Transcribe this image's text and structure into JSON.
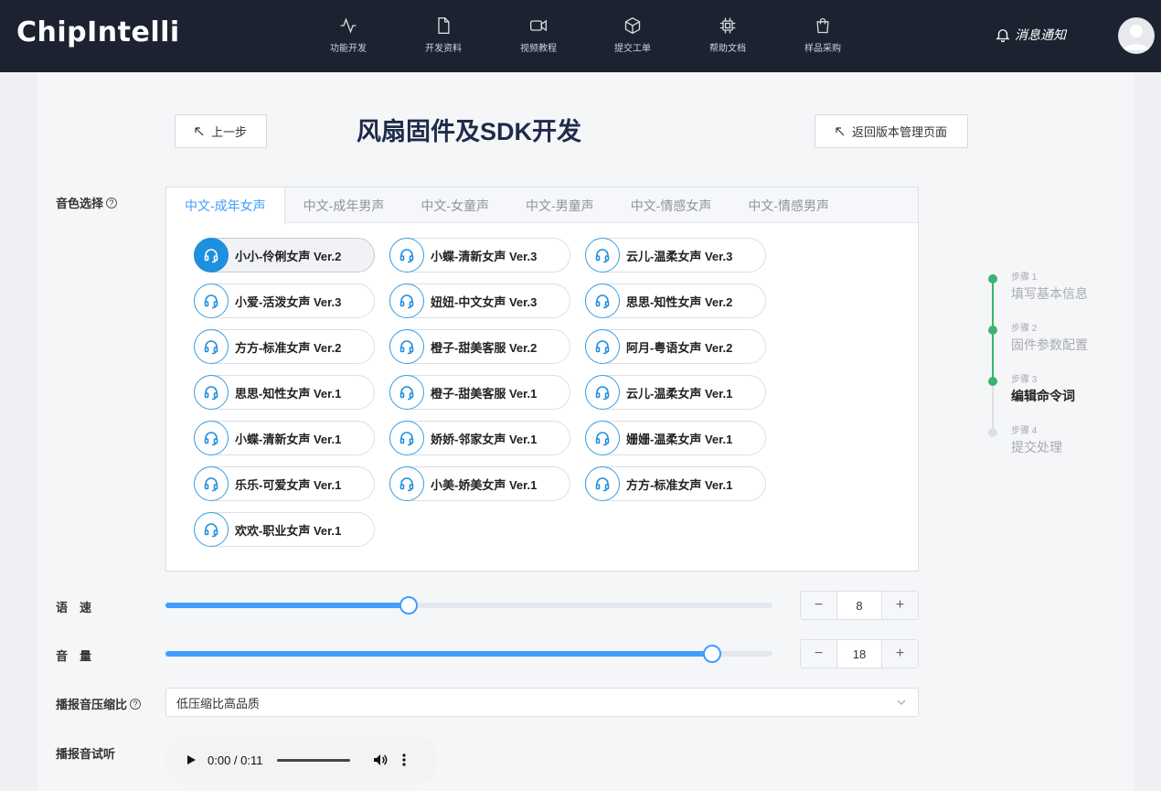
{
  "header": {
    "logo": "ChipIntelli",
    "nav": [
      {
        "label": "功能开发",
        "icon": "activity-icon"
      },
      {
        "label": "开发资料",
        "icon": "document-icon"
      },
      {
        "label": "视频教程",
        "icon": "video-icon"
      },
      {
        "label": "提交工单",
        "icon": "box-icon"
      },
      {
        "label": "帮助文档",
        "icon": "chip-icon"
      },
      {
        "label": "样品采购",
        "icon": "shopping-bag-icon"
      }
    ],
    "notification_label": "消息通知"
  },
  "page": {
    "back_button": "上一步",
    "title": "风扇固件及SDK开发",
    "return_button": "返回版本管理页面"
  },
  "voice": {
    "label": "音色选择",
    "tabs": [
      "中文-成年女声",
      "中文-成年男声",
      "中文-女童声",
      "中文-男童声",
      "中文-情感女声",
      "中文-情感男声"
    ],
    "active_tab": 0,
    "options": [
      "小小-伶俐女声 Ver.2",
      "小蝶-清新女声 Ver.3",
      "云儿-温柔女声 Ver.3",
      "小爱-活泼女声 Ver.3",
      "妞妞-中文女声 Ver.3",
      "思思-知性女声 Ver.2",
      "方方-标准女声 Ver.2",
      "橙子-甜美客服 Ver.2",
      "阿月-粤语女声 Ver.2",
      "思思-知性女声 Ver.1",
      "橙子-甜美客服 Ver.1",
      "云儿-温柔女声 Ver.1",
      "小蝶-清新女声 Ver.1",
      "娇娇-邻家女声 Ver.1",
      "姗姗-温柔女声 Ver.1",
      "乐乐-可爱女声 Ver.1",
      "小美-娇美女声 Ver.1",
      "方方-标准女声 Ver.1",
      "欢欢-职业女声 Ver.1"
    ],
    "selected_index": 0
  },
  "speed": {
    "label": "语　速",
    "value": "8",
    "fraction": 0.4,
    "minus": "−",
    "plus": "+"
  },
  "volume": {
    "label": "音　量",
    "value": "18",
    "fraction": 0.9,
    "minus": "−",
    "plus": "+"
  },
  "compression": {
    "label": "播报音压缩比",
    "selected": "低压缩比高品质"
  },
  "preview": {
    "label": "播报音试听",
    "time": "0:00 / 0:11"
  },
  "steps": [
    {
      "small": "步骤 1",
      "name": "填写基本信息",
      "state": "done"
    },
    {
      "small": "步骤 2",
      "name": "固件参数配置",
      "state": "done"
    },
    {
      "small": "步骤 3",
      "name": "编辑命令词",
      "state": "active"
    },
    {
      "small": "步骤 4",
      "name": "提交处理",
      "state": "pending"
    }
  ],
  "colors": {
    "header_bg": "#1c2230",
    "accent": "#409eff",
    "step_done": "#3cb371",
    "step_pending": "#dcdfe6"
  }
}
